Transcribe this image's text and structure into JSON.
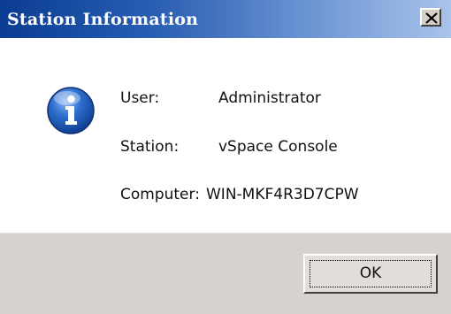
{
  "window": {
    "title": "Station Information"
  },
  "titlebar": {
    "close_icon": "close-icon"
  },
  "content": {
    "icon": "info-icon",
    "fields": [
      {
        "label": "User:",
        "value": "Administrator"
      },
      {
        "label": "Station:",
        "value": "vSpace Console"
      },
      {
        "label": "Computer:",
        "value": "WIN-MKF4R3D7CPW"
      }
    ]
  },
  "footer": {
    "ok_label": "OK"
  },
  "colors": {
    "titlebar_start": "#0a3d91",
    "titlebar_end": "#a9c3ea",
    "footer_bg": "#d6d3ce",
    "icon_blue": "#1f5fbf"
  }
}
